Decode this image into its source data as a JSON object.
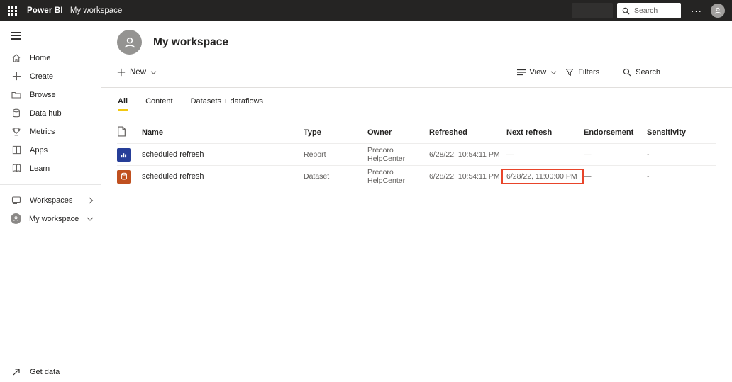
{
  "topbar": {
    "app_name": "Power BI",
    "workspace_label": "My workspace",
    "search_placeholder": "Search",
    "ellipsis": "···"
  },
  "sidebar": {
    "items": [
      {
        "label": "Home",
        "icon": "home-icon"
      },
      {
        "label": "Create",
        "icon": "plus-icon"
      },
      {
        "label": "Browse",
        "icon": "folder-icon"
      },
      {
        "label": "Data hub",
        "icon": "database-icon"
      },
      {
        "label": "Metrics",
        "icon": "metrics-icon"
      },
      {
        "label": "Apps",
        "icon": "apps-icon"
      },
      {
        "label": "Learn",
        "icon": "book-icon"
      }
    ],
    "workspaces_label": "Workspaces",
    "my_workspace_label": "My workspace",
    "get_data_label": "Get data"
  },
  "main": {
    "title": "My workspace",
    "new_label": "New",
    "view_label": "View",
    "filters_label": "Filters",
    "search_label": "Search",
    "tabs": [
      {
        "label": "All",
        "active": true
      },
      {
        "label": "Content",
        "active": false
      },
      {
        "label": "Datasets + dataflows",
        "active": false
      }
    ]
  },
  "table": {
    "columns": [
      "Name",
      "Type",
      "Owner",
      "Refreshed",
      "Next refresh",
      "Endorsement",
      "Sensitivity"
    ],
    "rows": [
      {
        "name": "scheduled refresh",
        "type": "Report",
        "owner": "Precoro HelpCenter",
        "refreshed": "6/28/22, 10:54:11 PM",
        "next_refresh": "—",
        "endorsement": "—",
        "sensitivity": "-",
        "icon": "report-tile-icon",
        "next_refresh_highlighted": false
      },
      {
        "name": "scheduled refresh",
        "type": "Dataset",
        "owner": "Precoro HelpCenter",
        "refreshed": "6/28/22, 10:54:11 PM",
        "next_refresh": "6/28/22, 11:00:00 PM",
        "endorsement": "—",
        "sensitivity": "-",
        "icon": "dataset-tile-icon",
        "next_refresh_highlighted": true
      }
    ]
  },
  "colors": {
    "topbar_bg": "#252423",
    "accent_yellow": "#F2C811",
    "report_tile_blue": "#263e98",
    "dataset_tile_orange": "#c0501f",
    "highlight_red": "#e8442a"
  }
}
